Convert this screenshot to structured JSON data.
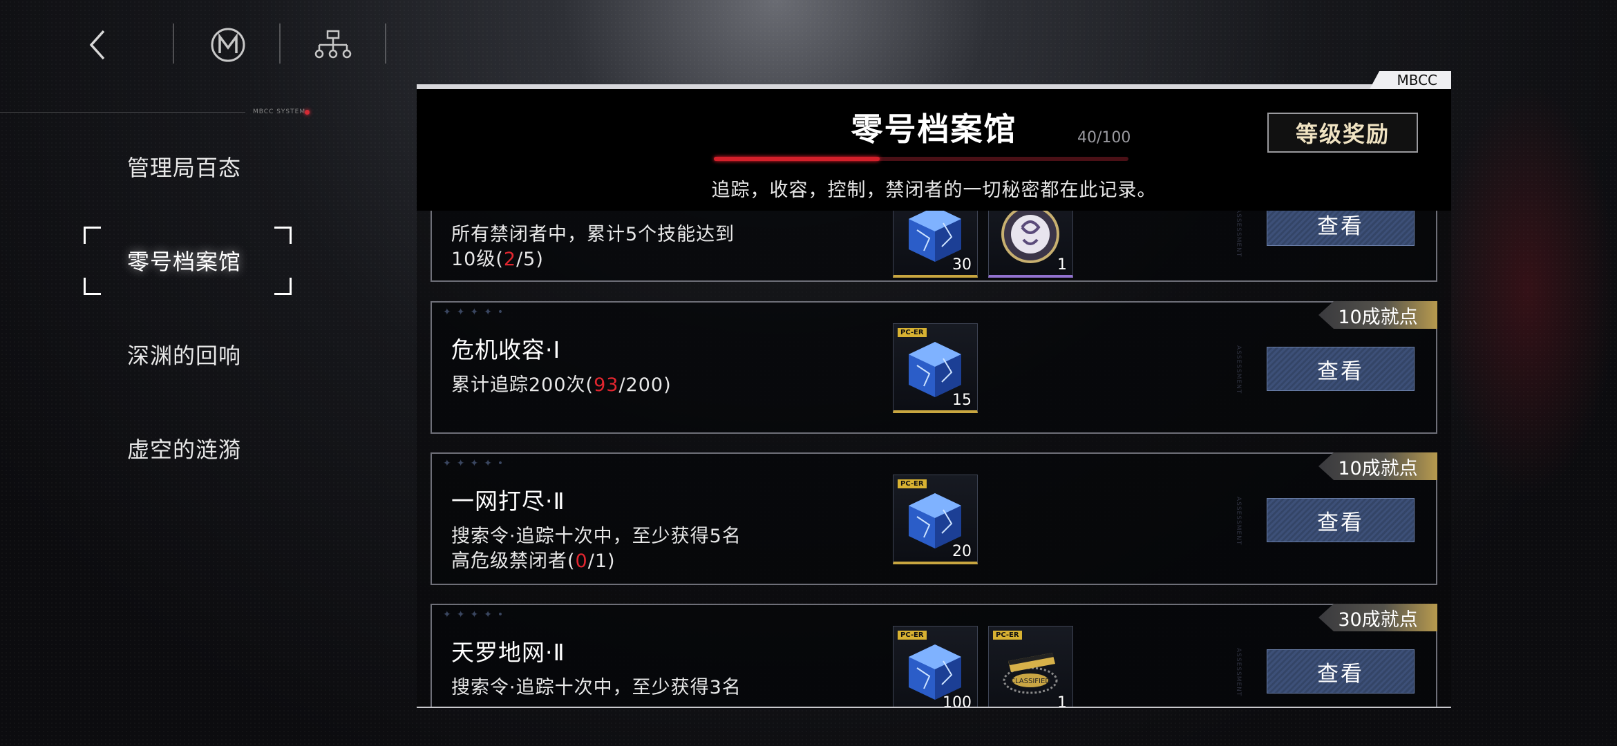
{
  "nav": {
    "back_icon": "chevron-left-icon",
    "logo_icon": "m-emblem-icon",
    "tree_icon": "hierarchy-icon",
    "system_label": "MBCC SYSTEM"
  },
  "menu": {
    "items": [
      {
        "label": "管理局百态"
      },
      {
        "label": "零号档案馆",
        "active": true
      },
      {
        "label": "深渊的回响"
      },
      {
        "label": "虚空的涟漪"
      }
    ]
  },
  "panel": {
    "tag": "MBCC",
    "title": "零号档案馆",
    "progress_text": "40/100",
    "progress_value": 0.4,
    "subtitle": "追踪，收容，控制，禁闭者的一切秘密都在此记录。",
    "reward_button": "等级奖励"
  },
  "colors": {
    "accent_red": "#d3202a",
    "button_blue": "#3d5078",
    "badge_gold": "#b79a4e",
    "reward_text": "#f0e3c2"
  },
  "cards": [
    {
      "title": "",
      "desc_line1": "所有禁闭者中，累计5个技能达到",
      "desc_line2_pre": "10级(",
      "desc_progress": "2",
      "desc_line2_post": "/5)",
      "badge": "",
      "items": [
        {
          "tag": "",
          "qty": "30",
          "kind": "cube"
        },
        {
          "tag": "",
          "qty": "1",
          "kind": "emblem"
        }
      ],
      "button": "查看"
    },
    {
      "title": "危机收容·Ⅰ",
      "desc_line1": "累计追踪200次(",
      "desc_progress": "93",
      "desc_line1_post": "/200)",
      "badge": "10成就点",
      "items": [
        {
          "tag": "PC-ER",
          "qty": "15",
          "kind": "cube"
        }
      ],
      "button": "查看"
    },
    {
      "title": "一网打尽·Ⅱ",
      "desc_line1": "搜索令·追踪十次中，至少获得5名",
      "desc_line2_pre": "高危级禁闭者(",
      "desc_progress": "0",
      "desc_line2_post": "/1)",
      "badge": "10成就点",
      "items": [
        {
          "tag": "PC-ER",
          "qty": "20",
          "kind": "cube"
        }
      ],
      "button": "查看"
    },
    {
      "title": "天罗地网·Ⅱ",
      "desc_line1": "搜索令·追踪十次中，至少获得3名",
      "badge": "30成就点",
      "items": [
        {
          "tag": "PC-ER",
          "qty": "100",
          "kind": "cube"
        },
        {
          "tag": "PC-ER",
          "qty": "1",
          "kind": "classified"
        }
      ],
      "item2_label": "CLASSIFIED",
      "button": "查看"
    }
  ],
  "assessment_label": "ASSESSMENT"
}
